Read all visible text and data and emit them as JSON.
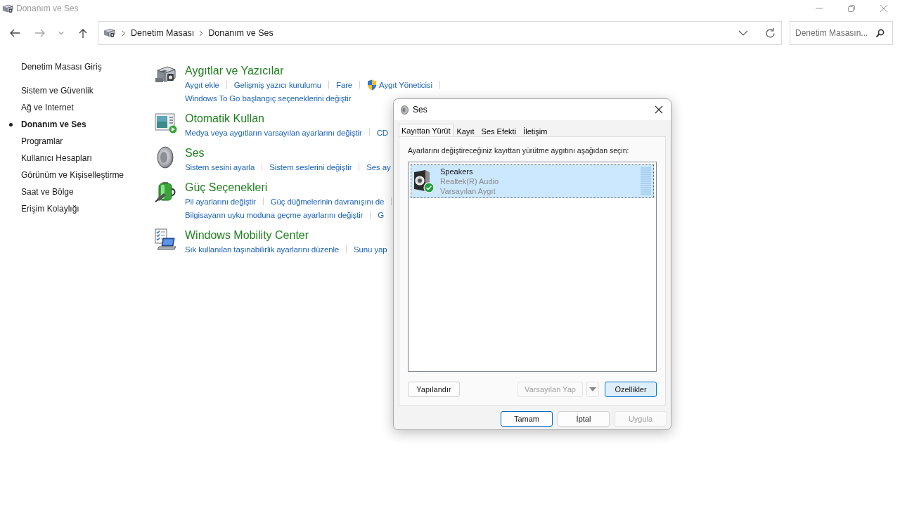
{
  "window": {
    "title": "Donanım ve Ses"
  },
  "navigation": {
    "buttons": [
      {
        "kind": "back",
        "disabled": false
      },
      {
        "kind": "forward",
        "disabled": true
      },
      {
        "kind": "recent",
        "disabled": false
      },
      {
        "kind": "up",
        "disabled": false
      }
    ],
    "breadcrumbs": [
      "Denetim Masası",
      "Donanım ve Ses"
    ],
    "search": {
      "placeholder": "Denetim Masasın..."
    }
  },
  "sidebar": {
    "home": "Denetim Masası Giriş",
    "items": [
      {
        "label": "Sistem ve Güvenlik",
        "selected": false
      },
      {
        "label": "Ağ ve Internet",
        "selected": false
      },
      {
        "label": "Donanım ve Ses",
        "selected": true
      },
      {
        "label": "Programlar",
        "selected": false
      },
      {
        "label": "Kullanıcı Hesapları",
        "selected": false
      },
      {
        "label": "Görünüm ve Kişiselleştirme",
        "selected": false
      },
      {
        "label": "Saat ve Bölge",
        "selected": false
      },
      {
        "label": "Erişim Kolaylığı",
        "selected": false
      }
    ]
  },
  "categories": [
    {
      "kind": "devices",
      "title": "Aygıtlar ve Yazıcılar",
      "lines": [
        [
          {
            "label": "Aygıt ekle",
            "shield": false
          },
          {
            "label": "Gelişmiş yazıcı kurulumu",
            "shield": false
          },
          {
            "label": "Fare",
            "shield": false
          },
          {
            "label": "Aygıt Yöneticisi",
            "shield": true
          }
        ],
        [
          {
            "label": "Windows To Go başlangıç seçeneklerini değiştir",
            "shield": false
          }
        ]
      ]
    },
    {
      "kind": "autoplay",
      "title": "Otomatik Kullan",
      "lines": [
        [
          {
            "label": "Medya veya aygıtların varsayılan ayarlarını değiştir",
            "shield": false
          },
          {
            "label": "CD",
            "shield": false
          }
        ]
      ]
    },
    {
      "kind": "sound",
      "title": "Ses",
      "lines": [
        [
          {
            "label": "Sistem sesini ayarla",
            "shield": false
          },
          {
            "label": "Sistem seslerini değiştir",
            "shield": false
          },
          {
            "label": "Ses ay",
            "shield": false
          }
        ]
      ]
    },
    {
      "kind": "power",
      "title": "Güç Seçenekleri",
      "lines": [
        [
          {
            "label": "Pil ayarlarını değiştir",
            "shield": false
          },
          {
            "label": "Güç düğmelerinin davranışını de",
            "shield": false
          }
        ],
        [
          {
            "label": "Bilgisayarın uyku moduna geçme ayarlarını değiştir",
            "shield": false
          },
          {
            "label": "G",
            "shield": false
          }
        ]
      ]
    },
    {
      "kind": "mobility",
      "title": "Windows Mobility Center",
      "lines": [
        [
          {
            "label": "Sık kullanılan taşınabilirlik ayarlarını düzenle",
            "shield": false
          },
          {
            "label": "Sunu yap",
            "shield": false
          }
        ]
      ]
    }
  ],
  "dialog": {
    "title": "Ses",
    "tabs": [
      {
        "label": "Kayıttan Yürüt",
        "selected": true
      },
      {
        "label": "Kayıt",
        "selected": false
      },
      {
        "label": "Ses Efekti",
        "selected": false
      },
      {
        "label": "İletişim",
        "selected": false
      }
    ],
    "instruction": "Ayarlarını değiştireceğiniz kayıttan yürütme aygıtını aşağıdan seçin:",
    "devices": [
      {
        "name": "Speakers",
        "driver": "Realtek(R) Audio",
        "status": "Varsayılan Aygıt",
        "selected": true,
        "default": true
      }
    ],
    "actions": [
      {
        "kind": "plain",
        "label": "Yapılandır",
        "disabled": false,
        "focused": false
      },
      {
        "kind": "split",
        "label": "Varsayılan Yap",
        "disabled": true,
        "focused": false
      },
      {
        "kind": "plain",
        "label": "Özellikler",
        "disabled": false,
        "focused": true
      }
    ],
    "buttons": [
      {
        "label": "Tamam",
        "default": true,
        "disabled": false
      },
      {
        "label": "İptal",
        "default": false,
        "disabled": false
      },
      {
        "label": "Uygula",
        "default": false,
        "disabled": true
      }
    ]
  }
}
